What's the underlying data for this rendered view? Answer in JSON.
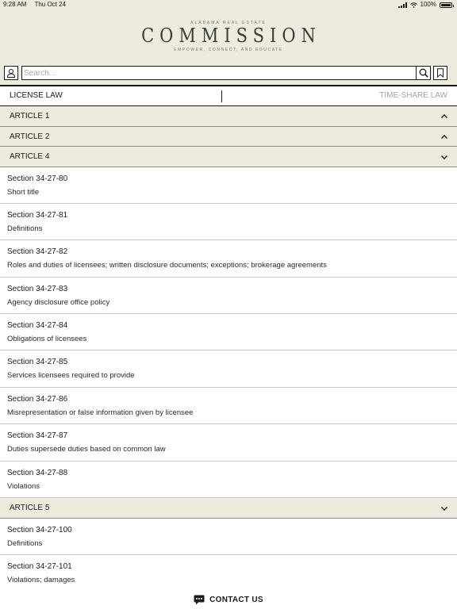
{
  "status_bar": {
    "time": "9:28 AM",
    "date": "Thu Oct 24",
    "battery": "100%",
    "icons": [
      "cellular-signal-icon",
      "wifi-icon",
      "battery-icon"
    ]
  },
  "logo": {
    "top_line": "ALABAMA REAL ESTATE",
    "main": "COMMISSION",
    "tagline": "EMPOWER, CONNECT, AND EDUCATE"
  },
  "search": {
    "placeholder": "Search...",
    "value": ""
  },
  "tabs": {
    "left": "LICENSE LAW",
    "right": "TIME-SHARE LAW",
    "active": "LICENSE LAW"
  },
  "articles": [
    {
      "label": "ARTICLE 1",
      "state": "collapsed",
      "chevron": "chevron-up-icon"
    },
    {
      "label": "ARTICLE 2",
      "state": "collapsed",
      "chevron": "chevron-up-icon"
    },
    {
      "label": "ARTICLE 4",
      "state": "expanded",
      "chevron": "chevron-down-icon"
    },
    {
      "label": "ARTICLE 5",
      "state": "expanded",
      "chevron": "chevron-down-icon"
    }
  ],
  "sections": [
    {
      "number": "Section 34-27-80",
      "title": "Short title"
    },
    {
      "number": "Section 34-27-81",
      "title": "Definitions"
    },
    {
      "number": "Section 34-27-82",
      "title": "Roles and duties of licensees; written disclosure documents; exceptions; brokerage agreements"
    },
    {
      "number": "Section 34-27-83",
      "title": "Agency disclosure office policy"
    },
    {
      "number": "Section 34-27-84",
      "title": "Obligations of licensees"
    },
    {
      "number": "Section 34-27-85",
      "title": "Services licensees required to provide"
    },
    {
      "number": "Section 34-27-86",
      "title": "Misrepresentation or false information given by licensee"
    },
    {
      "number": "Section 34-27-87",
      "title": "Duties supersede duties based on common law"
    },
    {
      "number": "Section 34-27-88",
      "title": "Violations"
    },
    {
      "number": "Section 34-27-100",
      "title": "Definitions"
    },
    {
      "number": "Section 34-27-101",
      "title": "Violations; damages"
    }
  ],
  "contact": {
    "label": "CONTACT US",
    "icon": "chat-bubble-icon"
  },
  "colors": {
    "header_bg": "#ecebde",
    "text": "#1a1a1a",
    "inactive_tab": "#a3a3a3"
  }
}
